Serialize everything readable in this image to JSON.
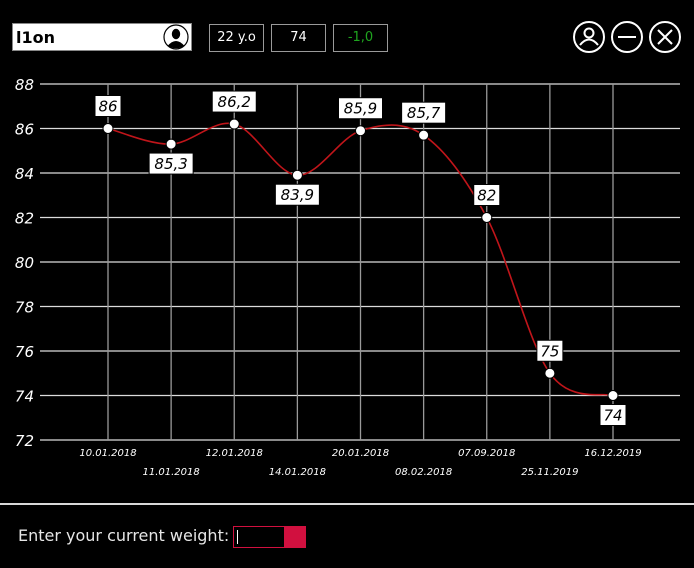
{
  "header": {
    "username": "l1on",
    "age": "22 y.o",
    "current_weight": "74",
    "weight_change": "-1,0",
    "weight_change_color": "#1fa51f",
    "avatar_icon": "user-silhouette-icon",
    "window_buttons": [
      "profile-icon",
      "minimize-icon",
      "close-icon"
    ]
  },
  "chart_data": {
    "type": "line",
    "categories": [
      "10.01.2018",
      "11.01.2018",
      "12.01.2018",
      "14.01.2018",
      "20.01.2018",
      "08.02.2018",
      "07.09.2018",
      "25.11.2019",
      "16.12.2019"
    ],
    "values": [
      86,
      85.3,
      86.2,
      83.9,
      85.9,
      85.7,
      82,
      75,
      74
    ],
    "point_labels": [
      "86",
      "85,3",
      "86,2",
      "83,9",
      "85,9",
      "85,7",
      "82",
      "75",
      "74"
    ],
    "label_position": [
      "above",
      "below",
      "above",
      "below",
      "above",
      "above",
      "above",
      "above",
      "below"
    ],
    "y_ticks": [
      "72",
      "74",
      "76",
      "78",
      "80",
      "82",
      "84",
      "86",
      "88"
    ],
    "ylim": [
      72,
      88
    ],
    "grid": true,
    "line_color": "#c0151a",
    "point_color": "#ffffff",
    "title": "",
    "xlabel": "",
    "ylabel": ""
  },
  "footer": {
    "prompt": "Enter your current weight:",
    "input_value": "",
    "accent_color": "#d1103f"
  }
}
